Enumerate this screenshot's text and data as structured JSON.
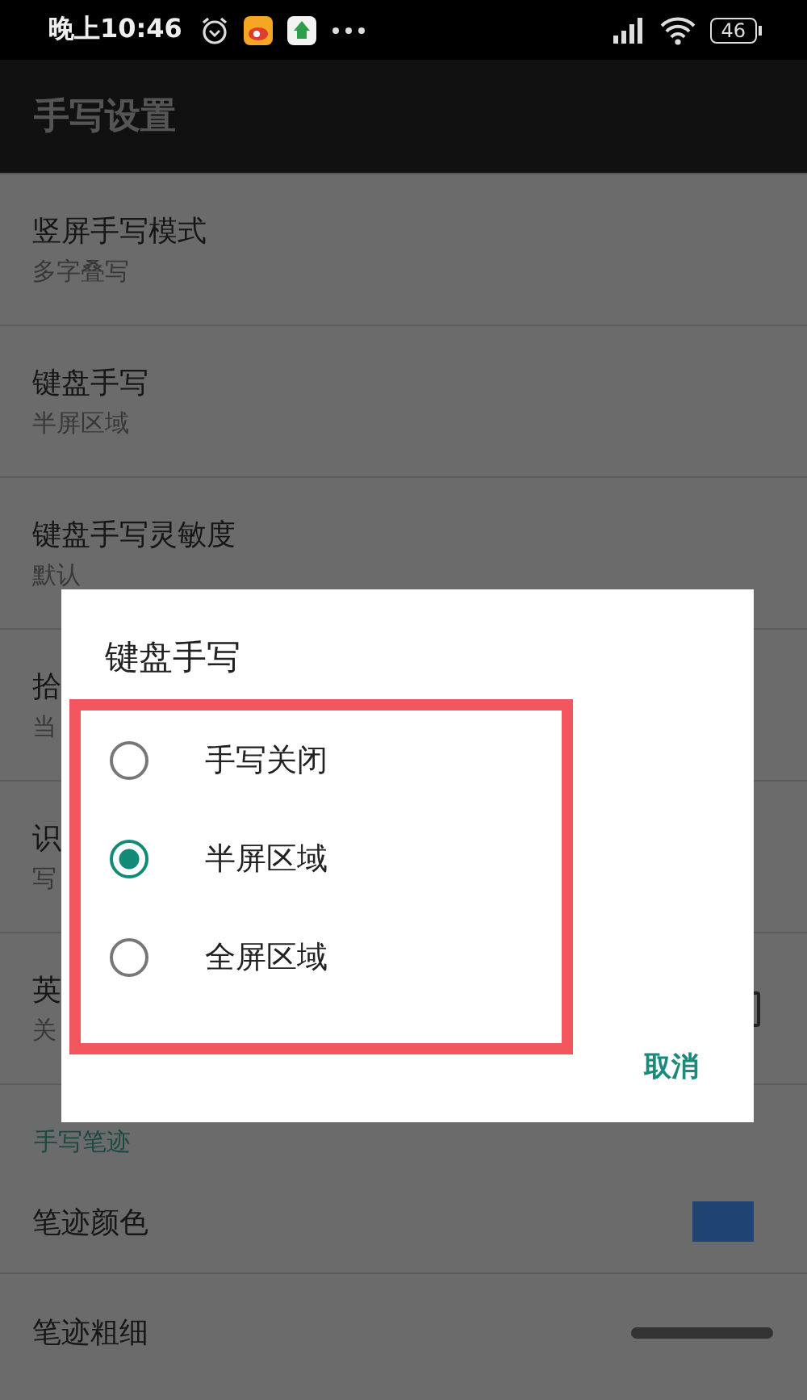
{
  "status_bar": {
    "time": "晚上10:46",
    "battery": "46"
  },
  "app_bar": {
    "title": "手写设置"
  },
  "settings": [
    {
      "kind": "item",
      "title": "竖屏手写模式",
      "summary": "多字叠写"
    },
    {
      "kind": "item",
      "title": "键盘手写",
      "summary": "半屏区域"
    },
    {
      "kind": "item",
      "title": "键盘手写灵敏度",
      "summary": "默认"
    },
    {
      "kind": "item",
      "title": "拾",
      "summary": "当"
    },
    {
      "kind": "item",
      "title": "识",
      "summary": "写"
    },
    {
      "kind": "checkbox",
      "title": "英",
      "summary": "关",
      "checked": false
    },
    {
      "kind": "category",
      "title": "手写笔迹"
    },
    {
      "kind": "color",
      "title": "笔迹颜色",
      "color": "#1f4473"
    },
    {
      "kind": "thickness",
      "title": "笔迹粗细"
    }
  ],
  "dialog": {
    "title": "键盘手写",
    "highlighted": true,
    "options": [
      {
        "label": "手写关闭",
        "selected": false
      },
      {
        "label": "半屏区域",
        "selected": true
      },
      {
        "label": "全屏区域",
        "selected": false
      }
    ],
    "buttons": [
      "取消"
    ]
  }
}
